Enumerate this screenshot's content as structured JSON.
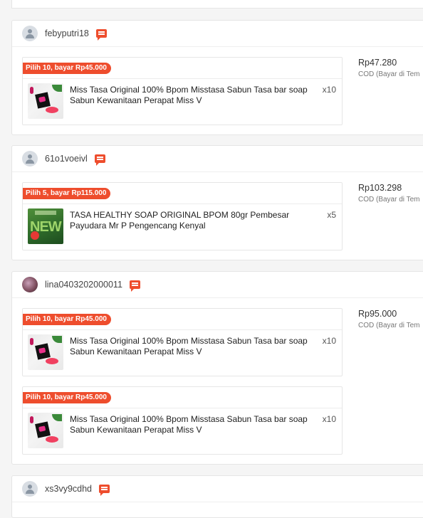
{
  "orders": [
    {
      "username": "febyputri18",
      "price": "Rp47.280",
      "payment": "COD (Bayar di Tem",
      "items": [
        {
          "promo": "Pilih 10, bayar Rp45.000",
          "title": "Miss Tasa Original 100% Bpom Misstasa Sabun Tasa bar soap Sabun Kewanitaan Perapat Miss V",
          "qty": "x10",
          "thumb": "miss-tasa-product-image"
        }
      ]
    },
    {
      "username": "61o1voeivl",
      "price": "Rp103.298",
      "payment": "COD (Bayar di Tem",
      "items": [
        {
          "promo": "Pilih 5, bayar Rp115.000",
          "title": "TASA HEALTHY SOAP ORIGINAL BPOM 80gr Pembesar Payudara Mr P Pengencang Kenyal",
          "qty": "x5",
          "thumb": "tasa-healthy-soap-product-image"
        }
      ]
    },
    {
      "username": "lina0403202000011",
      "price": "Rp95.000",
      "payment": "COD (Bayar di Tem",
      "items": [
        {
          "promo": "Pilih 10, bayar Rp45.000",
          "title": "Miss Tasa Original 100% Bpom Misstasa Sabun Tasa bar soap Sabun Kewanitaan Perapat Miss V",
          "qty": "x10",
          "thumb": "miss-tasa-product-image"
        },
        {
          "promo": "Pilih 10, bayar Rp45.000",
          "title": "Miss Tasa Original 100% Bpom Misstasa Sabun Tasa bar soap Sabun Kewanitaan Perapat Miss V",
          "qty": "x10",
          "thumb": "miss-tasa-product-image"
        }
      ]
    },
    {
      "username": "xs3vy9cdhd",
      "items": []
    }
  ],
  "colors": {
    "accent": "#ee4d2d",
    "border": "#e5e5e5",
    "background": "#f5f5f5"
  },
  "icons": {
    "chat": "chat-icon",
    "avatar": "user-avatar-icon"
  }
}
